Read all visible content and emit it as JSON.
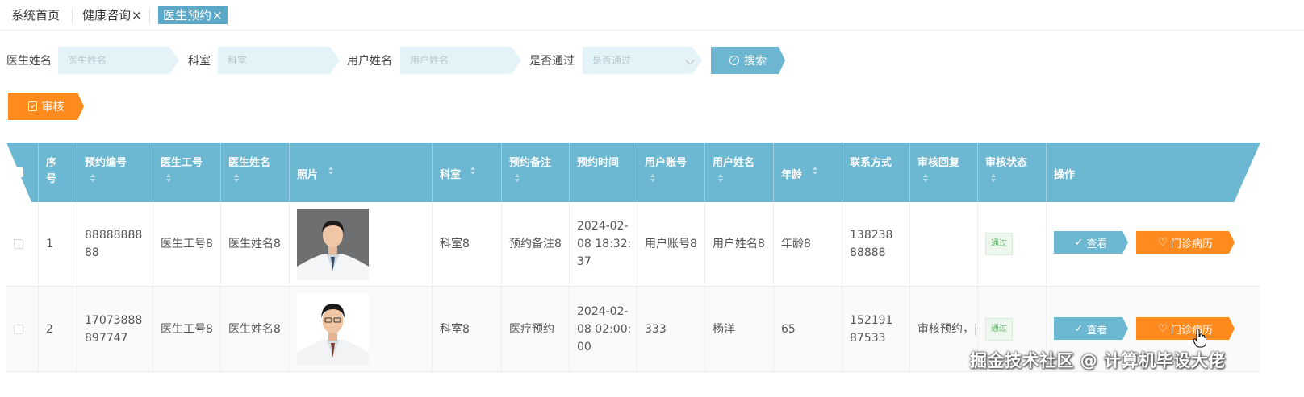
{
  "tabs": [
    {
      "label": "系统首页"
    },
    {
      "label": "健康咨询",
      "close": "×"
    },
    {
      "label": "医生预约",
      "close": "×"
    }
  ],
  "search": {
    "doctor_name_label": "医生姓名",
    "doctor_name_placeholder": "医生姓名",
    "department_label": "科室",
    "department_placeholder": "科室",
    "user_name_label": "用户姓名",
    "user_name_placeholder": "用户姓名",
    "approved_label": "是否通过",
    "approved_placeholder": "是否通过",
    "search_button": "搜索"
  },
  "toolbar": {
    "audit_button": "审核"
  },
  "table": {
    "headers": {
      "index": "序号",
      "booking_no": "预约编号",
      "doctor_id": "医生工号",
      "doctor_name": "医生姓名",
      "photo": "照片",
      "department": "科室",
      "booking_note": "预约备注",
      "booking_time": "预约时间",
      "user_account": "用户账号",
      "user_name": "用户姓名",
      "age": "年龄",
      "contact": "联系方式",
      "audit_reply": "审核回复",
      "audit_status": "审核状态",
      "actions": "操作"
    },
    "rows": [
      {
        "index": "1",
        "booking_no": "8888888888",
        "doctor_id": "医生工号8",
        "doctor_name": "医生姓名8",
        "department": "科室8",
        "booking_note": "预约备注8",
        "booking_time": "2024-02-08 18:32:37",
        "user_account": "用户账号8",
        "user_name": "用户姓名8",
        "age": "年龄8",
        "contact": "13823888888",
        "audit_reply": "",
        "audit_status": "通过",
        "view": "查看",
        "record": "门诊病历"
      },
      {
        "index": "2",
        "booking_no": "17073888897747",
        "doctor_id": "医生工号8",
        "doctor_name": "医生姓名8",
        "department": "科室8",
        "booking_note": "医疗预约",
        "booking_time": "2024-02-08 02:00:00",
        "user_account": "333",
        "user_name": "杨洋",
        "age": "65",
        "contact": "15219187533",
        "audit_reply": "审核预约，|",
        "audit_status": "通过",
        "view": "查看",
        "record": "门诊病历"
      }
    ]
  },
  "watermark": "掘金技术社区 @ 计算机毕设大佬",
  "colors": {
    "primary": "#6cb7d2",
    "orange": "#ff8a1d",
    "tab_active": "#5ba9c7",
    "input_bg": "#e4f3f8"
  }
}
